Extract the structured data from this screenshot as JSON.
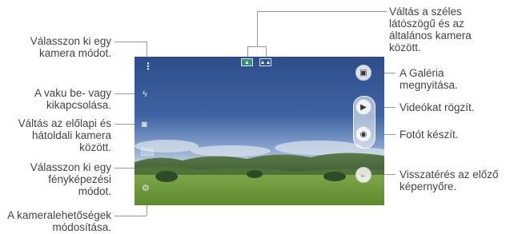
{
  "callouts": {
    "mode_select": [
      "Válasszon ki egy",
      "kamera módot."
    ],
    "flash_toggle": [
      "A vaku be- vagy",
      "kikapcsolása."
    ],
    "switch_camera": [
      "Váltás az előlapi és",
      "hátoldali kamera",
      "között."
    ],
    "photo_mode": [
      "Válasszon ki egy",
      "fényképezési",
      "módot."
    ],
    "camera_options": [
      "A kameralehetőségek",
      "módosítása."
    ],
    "wide_angle": [
      "Váltás a széles",
      "látószögű és az",
      "általános kamera",
      "között."
    ],
    "gallery": [
      "A Galéria",
      "megnyitása."
    ],
    "record_video": [
      "Videókat rögzít."
    ],
    "take_photo": [
      "Fotót készít."
    ],
    "back": [
      "Visszatérés az előző",
      "képernyőre."
    ]
  },
  "icons": {
    "menu": "more-vertical-icon",
    "flash": "flash-off-icon",
    "switch": "switch-camera-icon",
    "mode": "photo-mode-icon",
    "settings": "settings-icon",
    "wide": "wide-angle-icon",
    "normal": "normal-angle-icon",
    "gallery": "gallery-icon",
    "video": "video-camera-icon",
    "shutter": "camera-shutter-icon",
    "back": "back-arrow-icon"
  },
  "colors": {
    "sky_top": "#2d4d8a",
    "grass": "#6f9a3c",
    "lines": "#9a9a9a",
    "text": "#444444"
  }
}
